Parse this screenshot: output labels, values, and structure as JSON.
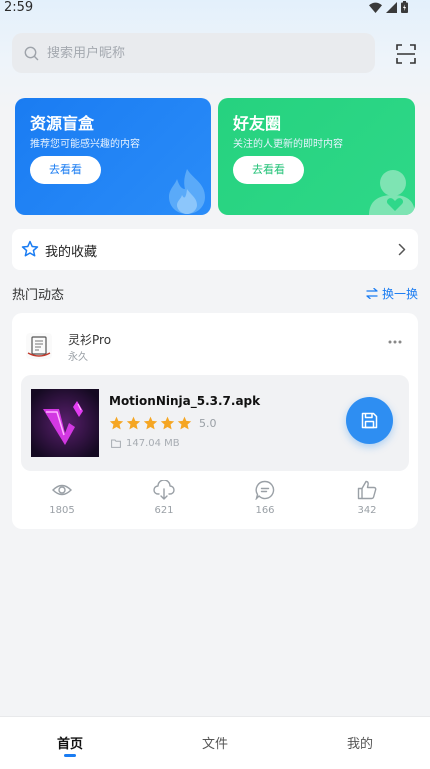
{
  "status_bar": {
    "time": "2:59"
  },
  "search": {
    "placeholder": "搜索用户昵称"
  },
  "cards": [
    {
      "title": "资源盲盒",
      "subtitle": "推荐您可能感兴趣的内容",
      "button": "去看看",
      "color": "#1a7cf2"
    },
    {
      "title": "好友圈",
      "subtitle": "关注的人更新的即时内容",
      "button": "去看看",
      "color": "#26d27f"
    }
  ],
  "favorites": {
    "label": "我的收藏"
  },
  "hot": {
    "title": "热门动态",
    "refresh_label": "换一换"
  },
  "post": {
    "author": "灵衫Pro",
    "author_sub": "永久",
    "file": {
      "name": "MotionNinja_5.3.7.apk",
      "rating": "5.0",
      "stars": 5,
      "size": "147.04 MB"
    },
    "stats": {
      "views": "1805",
      "downloads": "621",
      "comments": "166",
      "likes": "342"
    }
  },
  "tabs": [
    {
      "label": "首页",
      "active": true
    },
    {
      "label": "文件",
      "active": false
    },
    {
      "label": "我的",
      "active": false
    }
  ],
  "colors": {
    "accent": "#1a7cf2",
    "green": "#26d27f",
    "star": "#f5a623"
  }
}
